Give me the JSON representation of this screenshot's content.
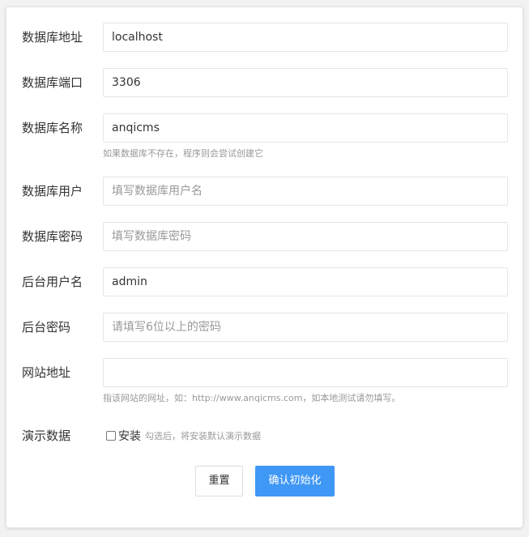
{
  "form": {
    "fields": [
      {
        "label": "数据库地址",
        "value": "localhost",
        "placeholder": ""
      },
      {
        "label": "数据库端口",
        "value": "3306",
        "placeholder": ""
      },
      {
        "label": "数据库名称",
        "value": "anqicms",
        "placeholder": "",
        "hint": "如果数据库不存在，程序则会尝试创建它"
      },
      {
        "label": "数据库用户",
        "value": "",
        "placeholder": "填写数据库用户名"
      },
      {
        "label": "数据库密码",
        "value": "",
        "placeholder": "填写数据库密码"
      },
      {
        "label": "后台用户名",
        "value": "admin",
        "placeholder": ""
      },
      {
        "label": "后台密码",
        "value": "",
        "placeholder": "请填写6位以上的密码"
      },
      {
        "label": "网站地址",
        "value": "",
        "placeholder": "",
        "hint": "指该网站的网址，如：http://www.anqicms.com，如本地测试请勿填写。"
      }
    ],
    "demo": {
      "label": "演示数据",
      "checkbox_label": "安装",
      "checked": false,
      "hint": "勾选后，将安装默认演示数据"
    },
    "buttons": {
      "reset_label": "重置",
      "submit_label": "确认初始化"
    }
  },
  "colors": {
    "primary": "#3f97f6",
    "border": "#e6e6e6",
    "hint_text": "#999999",
    "label_text": "#333333"
  }
}
